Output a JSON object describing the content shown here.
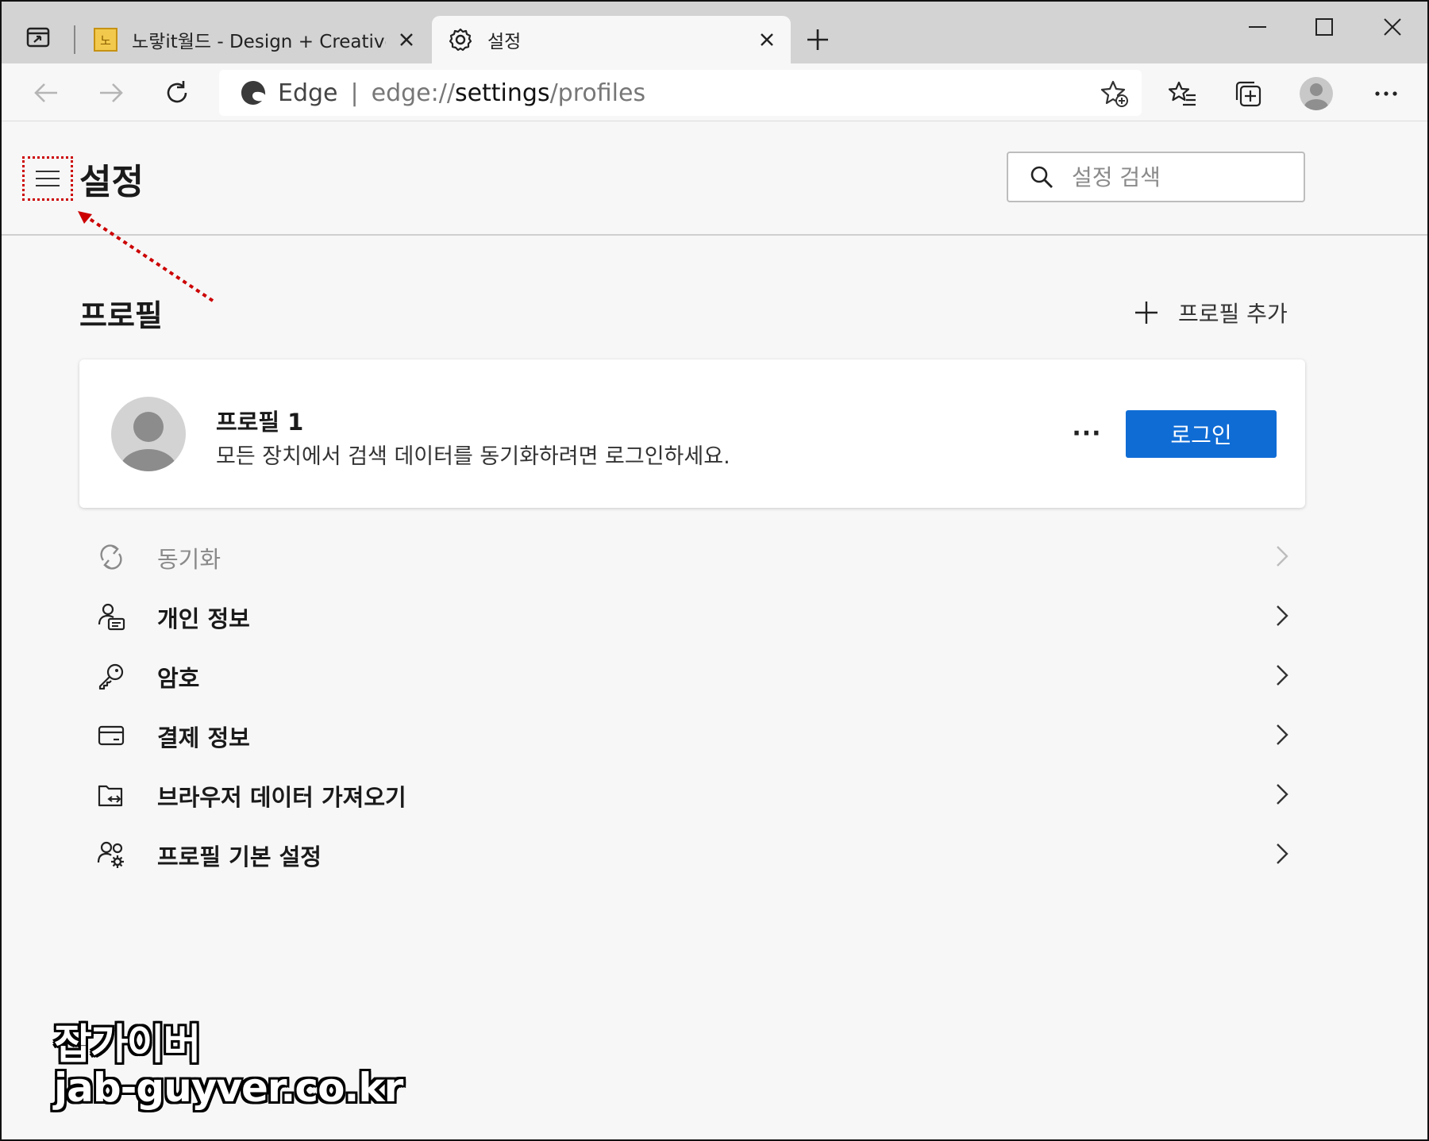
{
  "browser": {
    "tabs": [
      {
        "title": "노랗it월드 - Design + Creative + ",
        "favicon_text": "노"
      },
      {
        "title": "설정"
      }
    ],
    "address": {
      "site": "Edge",
      "separator": "|",
      "url_prefix": "edge://",
      "url_main": "settings",
      "url_suffix": "/profiles"
    },
    "colors": {
      "tabbar": "#d3d3d3",
      "accent": "#0f6cd5",
      "annotation": "#cc0000"
    }
  },
  "settings": {
    "title": "설정",
    "search_placeholder": "설정 검색"
  },
  "profiles": {
    "section_title": "프로필",
    "add_profile_label": "프로필 추가",
    "card": {
      "name": "프로필 1",
      "description": "모든 장치에서 검색 데이터를 동기화하려면 로그인하세요.",
      "more_label": "···",
      "login_label": "로그인"
    },
    "menu": [
      {
        "label": "동기화",
        "icon": "sync-icon",
        "disabled": true
      },
      {
        "label": "개인 정보",
        "icon": "personal-info-icon"
      },
      {
        "label": "암호",
        "icon": "key-icon"
      },
      {
        "label": "결제 정보",
        "icon": "card-icon"
      },
      {
        "label": "브라우저 데이터 가져오기",
        "icon": "import-data-icon"
      },
      {
        "label": "프로필 기본 설정",
        "icon": "profile-settings-icon"
      }
    ]
  },
  "watermark": {
    "line1": "잡가이버",
    "line2": "jab-guyver.co.kr"
  }
}
